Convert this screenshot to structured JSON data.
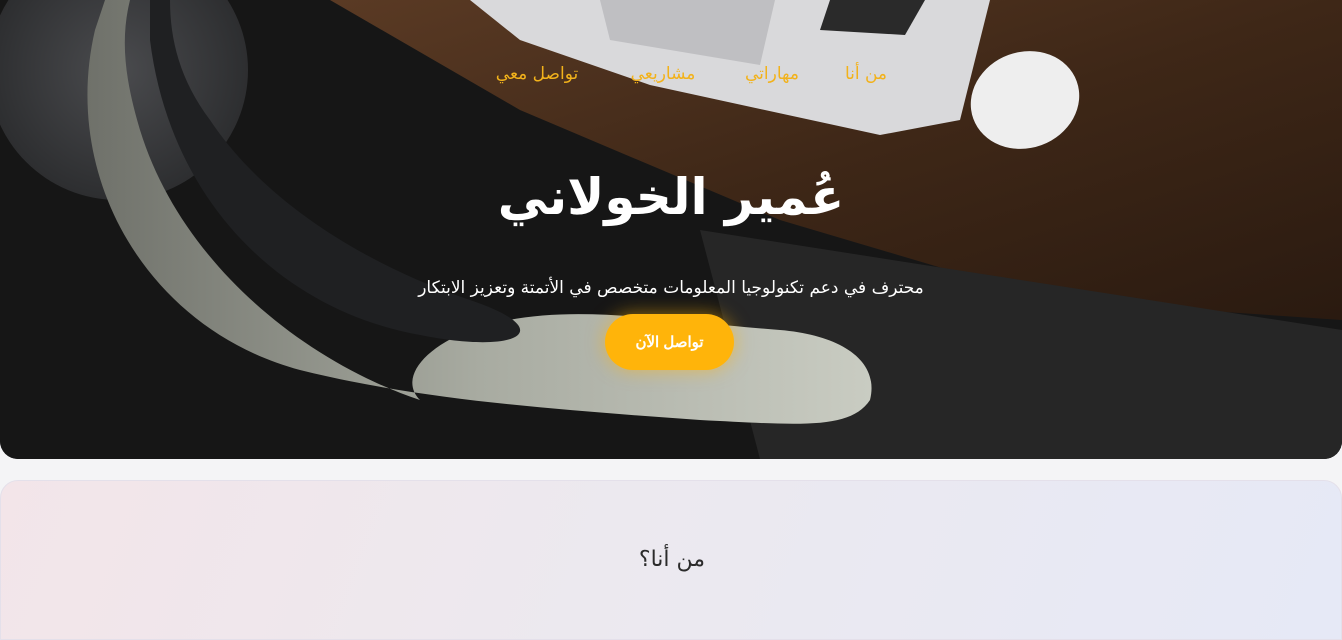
{
  "nav": {
    "items": [
      {
        "label": "من أنا"
      },
      {
        "label": "مهاراتي"
      },
      {
        "label": "مشاريعي"
      },
      {
        "label": "تواصل معي"
      }
    ]
  },
  "hero": {
    "title": "عُمير الخولاني",
    "subtitle": "محترف في دعم تكنولوجيا المعلومات متخصص في الأتمتة وتعزيز الابتكار",
    "cta_label": "تواصل الآن"
  },
  "about": {
    "title": "من أنا؟"
  },
  "colors": {
    "accent": "#ffb40a",
    "nav_text": "#f2b21b",
    "hero_text": "#ffffff"
  }
}
